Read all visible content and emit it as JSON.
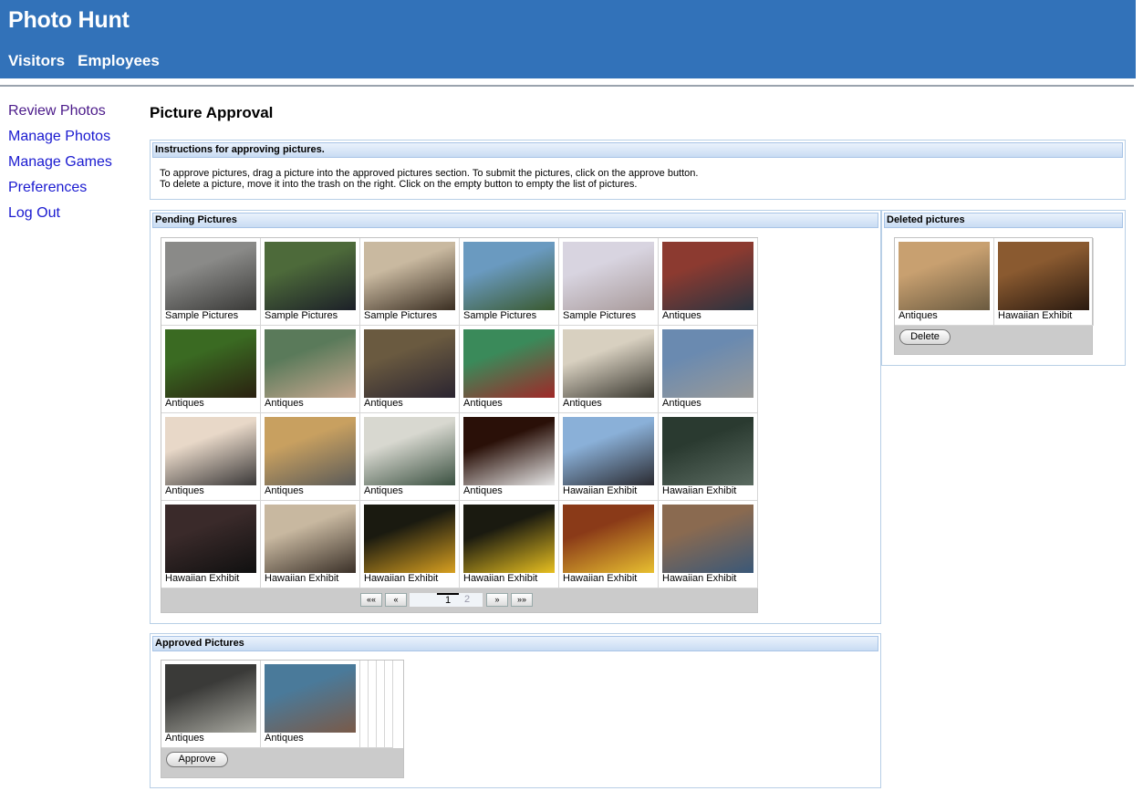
{
  "app": {
    "title": "Photo Hunt"
  },
  "topnav": {
    "visitors": "Visitors",
    "employees": "Employees"
  },
  "sidenav": {
    "review_photos": "Review Photos",
    "manage_photos": "Manage Photos",
    "manage_games": "Manage Games",
    "preferences": "Preferences",
    "log_out": "Log Out"
  },
  "page_title": "Picture Approval",
  "instructions": {
    "header": "Instructions for approving pictures.",
    "line1": "To approve pictures, drag a picture into the approved pictures section. To submit the pictures, click on the approve button.",
    "line2": "To delete a picture, move it into the trash on the right. Click on the empty button to empty the list of pictures."
  },
  "pending": {
    "header": "Pending Pictures",
    "items": [
      {
        "caption": "Sample Pictures",
        "colors": [
          "#8a8a88",
          "#3a3a38"
        ]
      },
      {
        "caption": "Sample Pictures",
        "colors": [
          "#4d6a3a",
          "#1c2028"
        ]
      },
      {
        "caption": "Sample Pictures",
        "colors": [
          "#c9b9a0",
          "#3a2e22"
        ]
      },
      {
        "caption": "Sample Pictures",
        "colors": [
          "#6a9ac0",
          "#3a5a30"
        ]
      },
      {
        "caption": "Sample Pictures",
        "colors": [
          "#d8d4e0",
          "#a89a9a"
        ]
      },
      {
        "caption": "Antiques",
        "colors": [
          "#8c3a30",
          "#2a3440"
        ]
      },
      {
        "caption": "Antiques",
        "colors": [
          "#3a6a22",
          "#2a2010"
        ]
      },
      {
        "caption": "Antiques",
        "colors": [
          "#5a7a5a",
          "#c8a890"
        ]
      },
      {
        "caption": "Antiques",
        "colors": [
          "#6a5a40",
          "#2a2430"
        ]
      },
      {
        "caption": "Antiques",
        "colors": [
          "#3a8a5a",
          "#a02828"
        ]
      },
      {
        "caption": "Antiques",
        "colors": [
          "#d8d0c0",
          "#3a3830"
        ]
      },
      {
        "caption": "Antiques",
        "colors": [
          "#6a8ab0",
          "#9a9a98"
        ]
      },
      {
        "caption": "Antiques",
        "colors": [
          "#e8d8c8",
          "#3a3838"
        ]
      },
      {
        "caption": "Antiques",
        "colors": [
          "#c8a060",
          "#5a5a58"
        ]
      },
      {
        "caption": "Antiques",
        "colors": [
          "#d8d8d0",
          "#3a5040"
        ]
      },
      {
        "caption": "Antiques",
        "colors": [
          "#2a1008",
          "#e8e8e8"
        ]
      },
      {
        "caption": "Hawaiian Exhibit",
        "colors": [
          "#8ab0d8",
          "#2a2a30"
        ]
      },
      {
        "caption": "Hawaiian Exhibit",
        "colors": [
          "#2a3a30",
          "#5a6a60"
        ]
      },
      {
        "caption": "Hawaiian Exhibit",
        "colors": [
          "#3a2a2a",
          "#101010"
        ]
      },
      {
        "caption": "Hawaiian Exhibit",
        "colors": [
          "#c8b8a0",
          "#3a3028"
        ]
      },
      {
        "caption": "Hawaiian Exhibit",
        "colors": [
          "#1a1a10",
          "#d8a020"
        ]
      },
      {
        "caption": "Hawaiian Exhibit",
        "colors": [
          "#1a1a10",
          "#e8c020"
        ]
      },
      {
        "caption": "Hawaiian Exhibit",
        "colors": [
          "#8a3a18",
          "#e8c030"
        ]
      },
      {
        "caption": "Hawaiian Exhibit",
        "colors": [
          "#8a6a50",
          "#3a5878"
        ]
      }
    ],
    "pager": {
      "first": "««",
      "prev": "«",
      "page_current": "1",
      "page_other": "2",
      "next": "»",
      "last": "»»"
    }
  },
  "deleted": {
    "header": "Deleted pictures",
    "items": [
      {
        "caption": "Antiques",
        "colors": [
          "#c8a070",
          "#6a5a40"
        ]
      },
      {
        "caption": "Hawaiian Exhibit",
        "colors": [
          "#8a5a30",
          "#2a1a10"
        ]
      }
    ],
    "delete_label": "Delete"
  },
  "approved": {
    "header": "Approved Pictures",
    "items": [
      {
        "caption": "Antiques",
        "colors": [
          "#3a3a38",
          "#a8a8a0"
        ]
      },
      {
        "caption": "Antiques",
        "colors": [
          "#4a7a9a",
          "#7a5a48"
        ]
      }
    ],
    "approve_label": "Approve"
  },
  "colors": {
    "header_bg": "#3272b9",
    "link": "#1a1ad0",
    "panel_header": "#c9dcf3"
  }
}
